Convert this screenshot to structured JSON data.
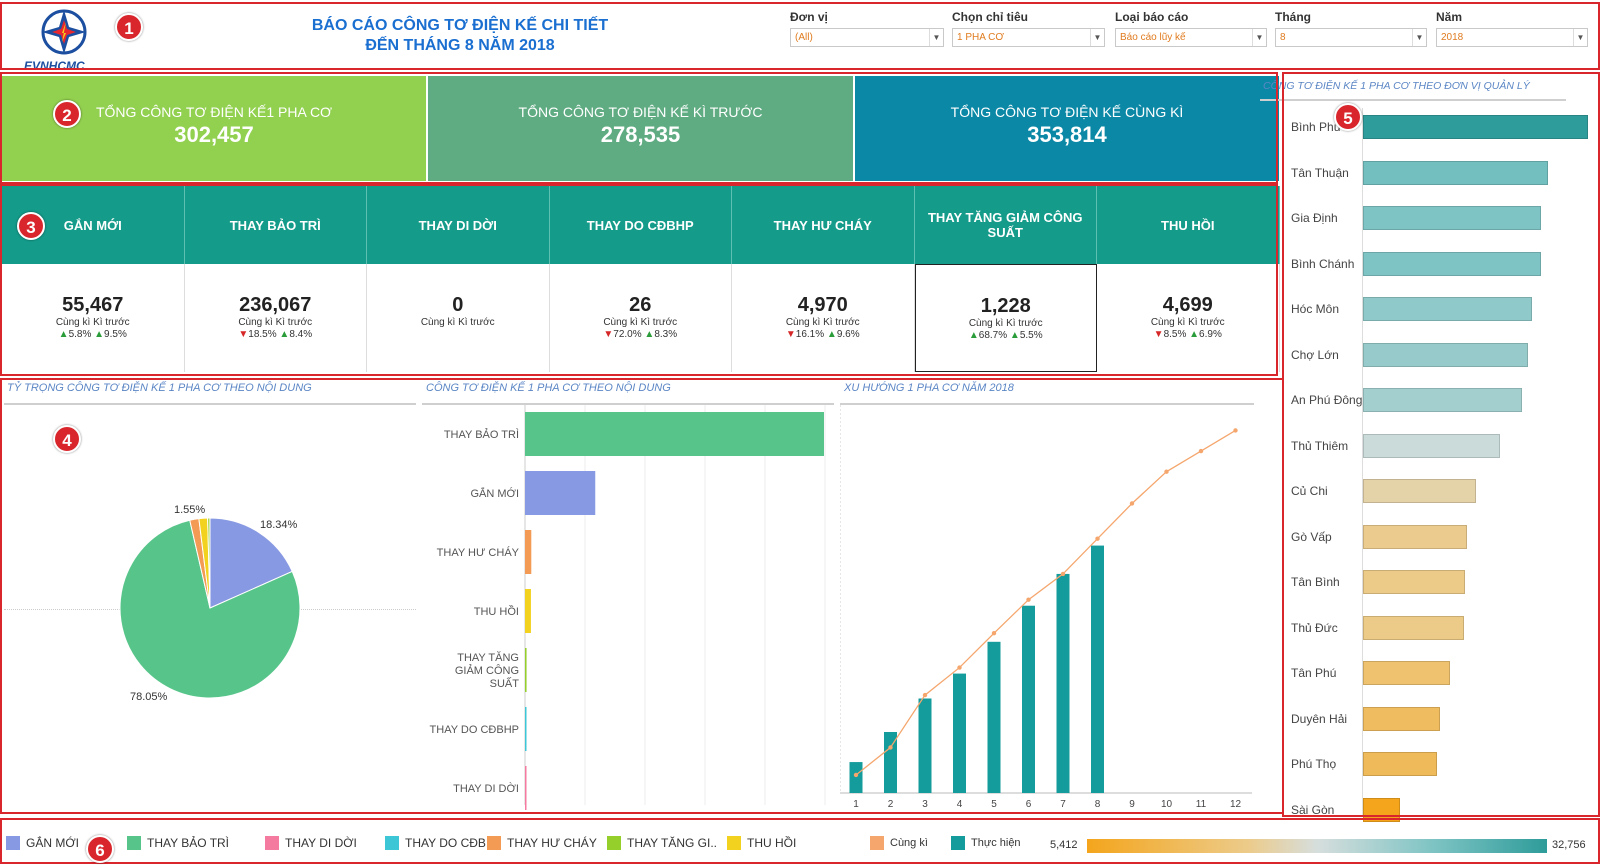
{
  "header": {
    "logo_text": "EVNHCMC",
    "title_line1": "BÁO CÁO CÔNG TƠ ĐIỆN KẾ CHI TIẾT",
    "title_line2": "ĐẾN THÁNG 8 NĂM 2018",
    "filters": [
      {
        "label": "Đơn vị",
        "value": "(All)"
      },
      {
        "label": "Chọn chỉ tiêu",
        "value": "1 PHA CƠ"
      },
      {
        "label": "Loại báo cáo",
        "value": "Báo cáo lũy kế"
      },
      {
        "label": "Tháng",
        "value": "8"
      },
      {
        "label": "Năm",
        "value": "2018"
      }
    ]
  },
  "badges": [
    "1",
    "2",
    "3",
    "4",
    "5",
    "6"
  ],
  "kpis": [
    {
      "label": "TỔNG CÔNG TƠ ĐIỆN KẾ1 PHA CƠ",
      "value": "302,457",
      "color": "#92d04f"
    },
    {
      "label": "TỔNG CÔNG TƠ ĐIỆN KẾ KÌ TRƯỚC",
      "value": "278,535",
      "color": "#5fab82"
    },
    {
      "label": "TỔNG CÔNG TƠ ĐIỆN KẾ CÙNG KÌ",
      "value": "353,814",
      "color": "#0b88a6"
    }
  ],
  "metrics": [
    {
      "head": "GẮN MỚI",
      "value": "55,467",
      "sub": "Cùng kì  Kì trước",
      "ck_dir": "up",
      "ck": "5.8%",
      "kt_dir": "up",
      "kt": "9.5%"
    },
    {
      "head": "THAY BẢO TRÌ",
      "value": "236,067",
      "sub": "Cùng kì  Kì trước",
      "ck_dir": "down",
      "ck": "18.5%",
      "kt_dir": "up",
      "kt": "8.4%"
    },
    {
      "head": "THAY DI DỜI",
      "value": "0",
      "sub": "Cùng kì  Kì trước",
      "ck_dir": "",
      "ck": "",
      "kt_dir": "",
      "kt": ""
    },
    {
      "head": "THAY DO CĐBHP",
      "value": "26",
      "sub": "Cùng kì  Kì trước",
      "ck_dir": "down",
      "ck": "72.0%",
      "kt_dir": "up",
      "kt": "8.3%"
    },
    {
      "head": "THAY HƯ CHÁY",
      "value": "4,970",
      "sub": "Cùng kì  Kì trước",
      "ck_dir": "down",
      "ck": "16.1%",
      "kt_dir": "up",
      "kt": "9.6%"
    },
    {
      "head": "THAY TĂNG GIẢM CÔNG SUẤT",
      "value": "1,228",
      "sub": "Cùng kì  Kì trước",
      "ck_dir": "up",
      "ck": "68.7%",
      "kt_dir": "up",
      "kt": "5.5%"
    },
    {
      "head": "THU HỒI",
      "value": "4,699",
      "sub": "Cùng kì  Kì trước",
      "ck_dir": "down",
      "ck": "8.5%",
      "kt_dir": "up",
      "kt": "6.9%"
    }
  ],
  "panels": {
    "pie_title": "TỶ TRỌNG CÔNG TƠ ĐIỆN KẾ 1 PHA CƠ THEO NỘI DUNG",
    "bar_title": "CÔNG TƠ ĐIỆN KẾ 1 PHA CƠ THEO NỘI DUNG",
    "trend_title": "XU HƯỚNG 1 PHA CƠ NĂM 2018",
    "unit_title": "CÔNG TƠ ĐIỆN KẾ 1 PHA CƠ THEO ĐƠN VỊ QUẢN LÝ"
  },
  "colors": {
    "gan_moi": "#8799e2",
    "thay_bao_tri": "#57c58a",
    "thay_di_doi": "#f47aa0",
    "thay_do_cdbhp": "#3cc6d6",
    "thay_hu_chay": "#f39a55",
    "thay_tang_giam": "#95cf2b",
    "thu_hoi": "#f2d21f",
    "cung_ki": "#f5a66d",
    "thuc_hien": "#149b9b"
  },
  "chart_data": [
    {
      "type": "pie",
      "categories": [
        "GẮN MỚI",
        "THAY BẢO TRÌ",
        "THAY HƯ CHÁY",
        "THU HỒI",
        "THAY TĂNG GIẢM CÔNG SUẤT",
        "THAY DO CĐBHP",
        "THAY DI DỜI"
      ],
      "values": [
        18.34,
        78.05,
        1.64,
        1.55,
        0.41,
        0.01,
        0
      ],
      "labels_shown": [
        "18.34%",
        "78.05%",
        "1.55%"
      ]
    },
    {
      "type": "bar",
      "orientation": "horizontal",
      "categories": [
        "THAY BẢO TRÌ",
        "GẮN MỚI",
        "THAY HƯ CHÁY",
        "THU HỒI",
        "THAY TĂNG GIẢM CÔNG SUẤT",
        "THAY DO CĐBHP",
        "THAY DI DỜI"
      ],
      "values": [
        236067,
        55467,
        4970,
        4699,
        1228,
        26,
        0
      ]
    },
    {
      "type": "bar+line",
      "x": [
        1,
        2,
        3,
        4,
        5,
        6,
        7,
        8,
        9,
        10,
        11,
        12
      ],
      "series": [
        {
          "name": "Thực hiện",
          "type": "bar",
          "values": [
            36000,
            71000,
            110000,
            139000,
            176000,
            218000,
            255000,
            288000,
            null,
            null,
            null,
            null
          ]
        },
        {
          "name": "Cùng kì",
          "type": "line",
          "values": [
            21000,
            53000,
            114000,
            146000,
            186000,
            225000,
            255000,
            296000,
            337000,
            374000,
            398000,
            422000
          ]
        }
      ]
    },
    {
      "type": "bar",
      "orientation": "horizontal",
      "categories": [
        "Bình Phú",
        "Tân Thuận",
        "Gia Định",
        "Bình Chánh",
        "Hóc Môn",
        "Chợ Lớn",
        "An Phú Đông",
        "Thủ Thiêm",
        "Củ Chi",
        "Gò Vấp",
        "Tân Bình",
        "Thủ Đức",
        "Tân Phú",
        "Duyên Hải",
        "Phú Thọ",
        "Sài Gòn"
      ],
      "values": [
        32756,
        26900,
        25900,
        25900,
        24600,
        24000,
        23100,
        20000,
        16500,
        15200,
        14800,
        14700,
        12600,
        11200,
        10800,
        5412
      ],
      "colorscale": {
        "min": 5412,
        "max": 32756
      }
    }
  ],
  "legend": {
    "items": [
      {
        "label": "GẮN MỚI",
        "color": "#8799e2"
      },
      {
        "label": "THAY BẢO TRÌ",
        "color": "#57c58a"
      },
      {
        "label": "THAY DI DỜI",
        "color": "#f47aa0"
      },
      {
        "label": "THAY DO CĐB..",
        "color": "#3cc6d6"
      },
      {
        "label": "THAY HƯ CHÁY",
        "color": "#f39a55"
      },
      {
        "label": "THAY TĂNG GI..",
        "color": "#95cf2b"
      },
      {
        "label": "THU HỒI",
        "color": "#f2d21f"
      }
    ],
    "cung_ki": "Cùng kì",
    "thuc_hien": "Thực hiện",
    "scale_min": "5,412",
    "scale_max": "32,756"
  }
}
